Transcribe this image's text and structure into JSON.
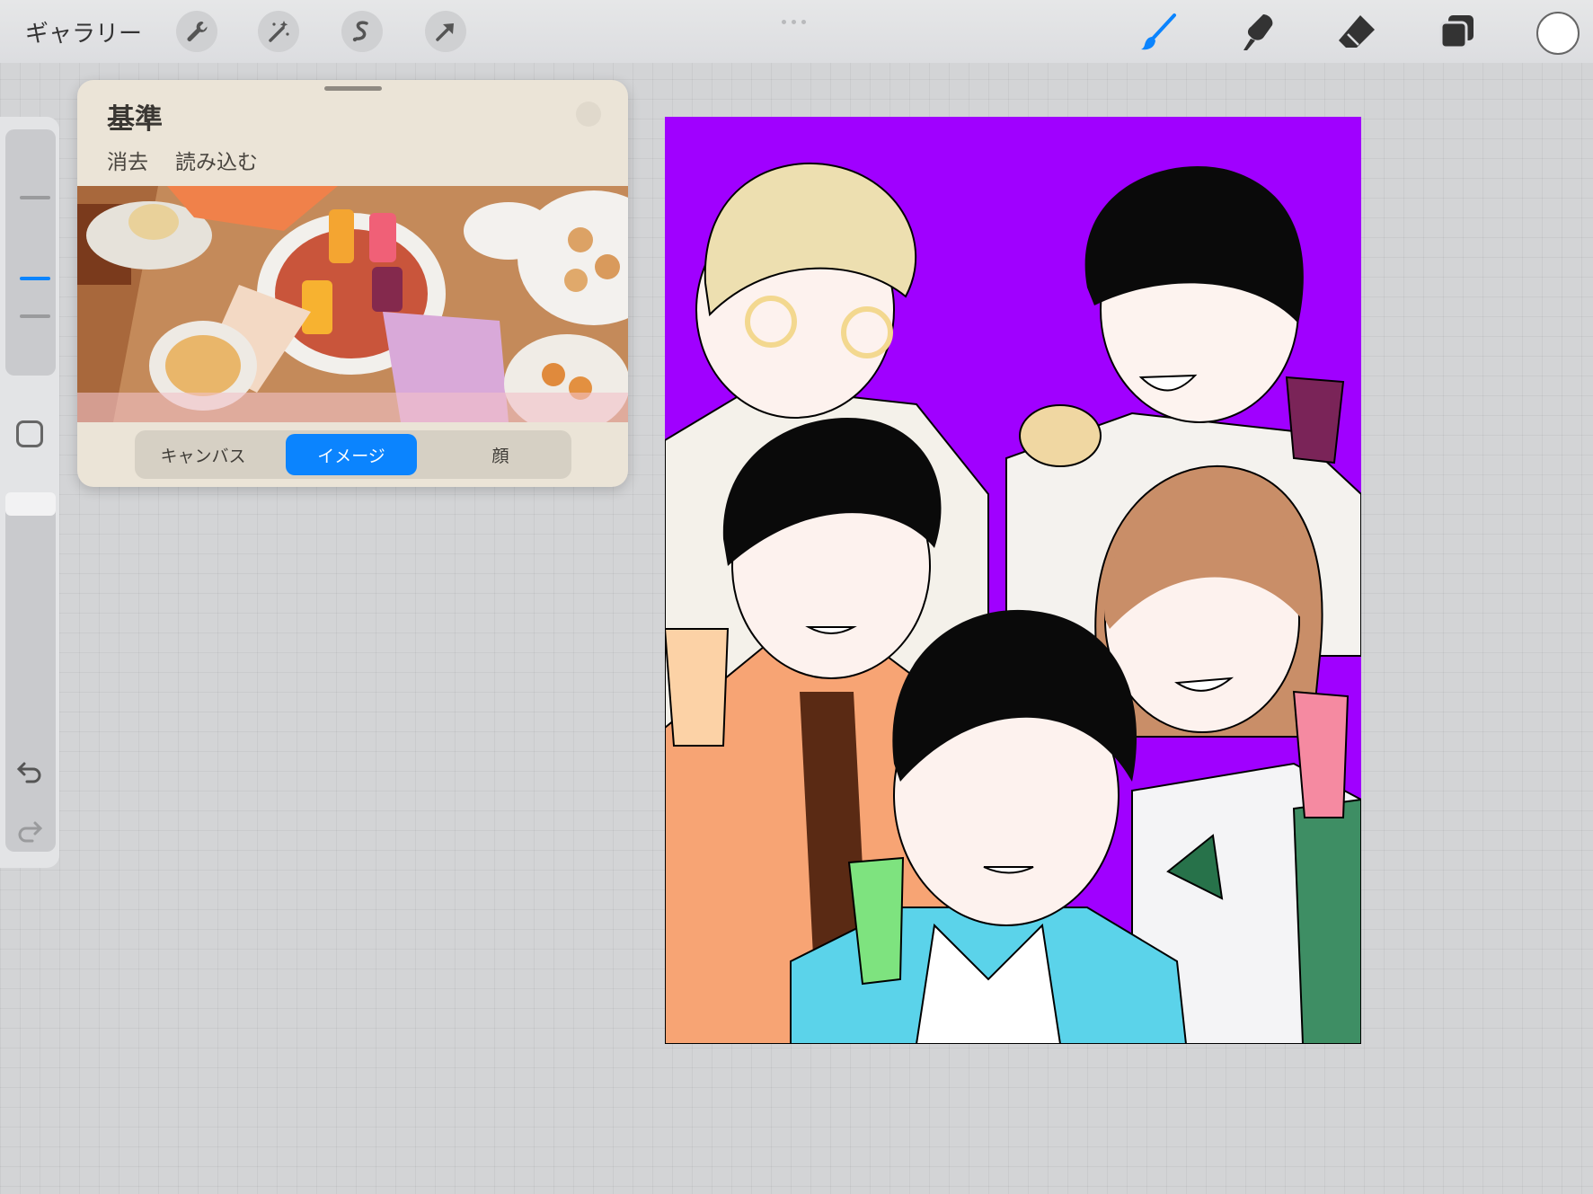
{
  "topbar": {
    "gallery_label": "ギャラリー",
    "left_tools": [
      "wrench-icon",
      "magic-wand-icon",
      "selection-icon",
      "transform-arrow-icon"
    ],
    "right_tools": [
      "brush-icon",
      "smudge-icon",
      "eraser-icon",
      "layers-icon"
    ],
    "active_tool": "brush",
    "current_color": "#ffffff",
    "accent_color": "#0b84fe"
  },
  "sidebar": {
    "undo_icon": "undo-icon",
    "redo_icon": "redo-icon",
    "modify_icon": "square-icon"
  },
  "reference_panel": {
    "title": "基準",
    "clear_label": "消去",
    "import_label": "読み込む",
    "tabs": [
      "キャンバス",
      "イメージ",
      "顔"
    ],
    "active_tab": "イメージ"
  },
  "canvas": {
    "background_color": "#a000ff"
  }
}
